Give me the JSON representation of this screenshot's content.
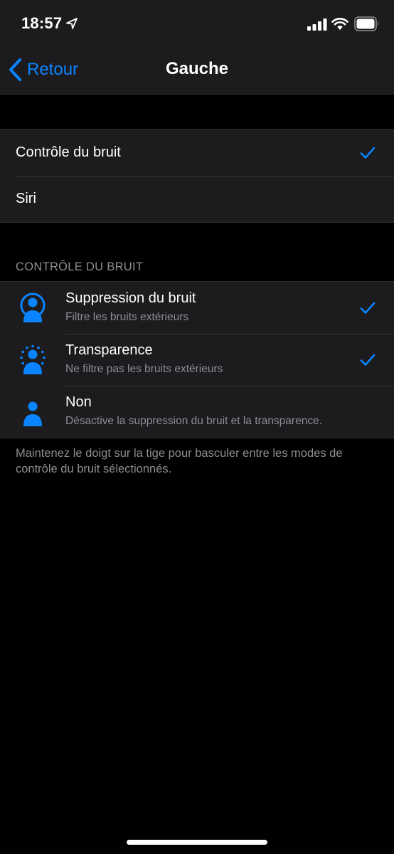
{
  "status_bar": {
    "time": "18:57",
    "icons": [
      "location-arrow-icon",
      "cellular-signal-icon",
      "wifi-icon",
      "battery-icon"
    ]
  },
  "nav": {
    "back_label": "Retour",
    "title": "Gauche"
  },
  "press_action": {
    "items": [
      {
        "label": "Contrôle du bruit",
        "selected": true
      },
      {
        "label": "Siri",
        "selected": false
      }
    ]
  },
  "noise_control": {
    "header": "CONTRÔLE DU BRUIT",
    "modes": [
      {
        "title": "Suppression du bruit",
        "subtitle": "Filtre les bruits extérieurs",
        "selected": true,
        "icon": "noise-cancellation-icon"
      },
      {
        "title": "Transparence",
        "subtitle": "Ne filtre pas les bruits extérieurs",
        "selected": true,
        "icon": "transparency-icon"
      },
      {
        "title": "Non",
        "subtitle": "Désactive la suppression du bruit et la transparence.",
        "selected": false,
        "icon": "noise-off-icon"
      }
    ],
    "footer": "Maintenez le doigt sur la tige pour basculer entre les modes de contrôle du bruit sélectionnés."
  },
  "colors": {
    "accent": "#0a84ff",
    "background": "#000000",
    "cell": "#1c1c1e",
    "secondary_text": "#8d8d93"
  }
}
